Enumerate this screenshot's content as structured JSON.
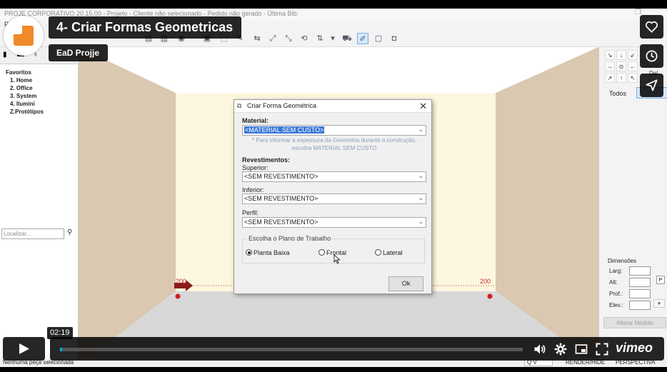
{
  "app": {
    "title_bar": "PROJE CORPORATIVO 20.15.00  -  Projeto  -  Cliente não selecionado  -  Pedido não gerado  -  Última Bib:",
    "menu": "P"
  },
  "left_panel": {
    "tree": [
      {
        "label": "Favoritos",
        "level": 0
      },
      {
        "label": "1. Home",
        "level": 1
      },
      {
        "label": "2. Office",
        "level": 1
      },
      {
        "label": "3. System",
        "level": 1
      },
      {
        "label": "4. Ilumini",
        "level": 1
      },
      {
        "label": "Z.Protótipos",
        "level": 1
      }
    ],
    "search_placeholder": "Localizar..."
  },
  "room": {
    "left_marker": "200",
    "right_marker": "200"
  },
  "right_panel": {
    "arrows": [
      "↘",
      "↓",
      "↙",
      "→",
      "⊙",
      "←",
      "↗",
      "↑",
      "↖"
    ],
    "del_label": "Del",
    "todos_tab": "Todos",
    "dimensions_title": "Dimensões",
    "dims": [
      {
        "label": "Larg:"
      },
      {
        "label": "Alt:"
      },
      {
        "label": "Prof.:"
      },
      {
        "label": "Elev.:"
      }
    ],
    "p_button": "P",
    "plus_button": "+",
    "alterar_button": "Alterar Módulo"
  },
  "statusbar": {
    "left_text": "Nenhuma peça selecionada",
    "render": "RENDER/HIDE",
    "perspective": "PERSPECTIVA",
    "q_box": "Q       V"
  },
  "dialog": {
    "title": "Criar Forma Geométrica",
    "material_label": "Material:",
    "material_value": "<MATERIAL SEM CUSTO>",
    "hint": "* Para informar a espessura da Geometria durante a construção, escolha MATERIAL SEM CUSTO",
    "revestimentos_label": "Revestimentos:",
    "superior_label": "Superior:",
    "superior_value": "<SEM REVESTIMENTO>",
    "inferior_label": "Inferior:",
    "inferior_value": "<SEM REVESTIMENTO>",
    "perfil_label": "Perfil:",
    "perfil_value": "<SEM REVESTIMENTO>",
    "plane_legend": "Escolha o Plano de Trabalho",
    "radios": [
      {
        "label": "Planta Baixa",
        "checked": true
      },
      {
        "label": "Frontal",
        "checked": false
      },
      {
        "label": "Lateral",
        "checked": false
      }
    ],
    "ok_label": "Ok"
  },
  "video": {
    "title": "4- Criar Formas Geometricas",
    "author": "EaD Projje",
    "timecode": "02:19",
    "progress": 0.004,
    "brand": "vimeo",
    "progress_color": "#00adef",
    "logo_color": "#f18a28"
  }
}
